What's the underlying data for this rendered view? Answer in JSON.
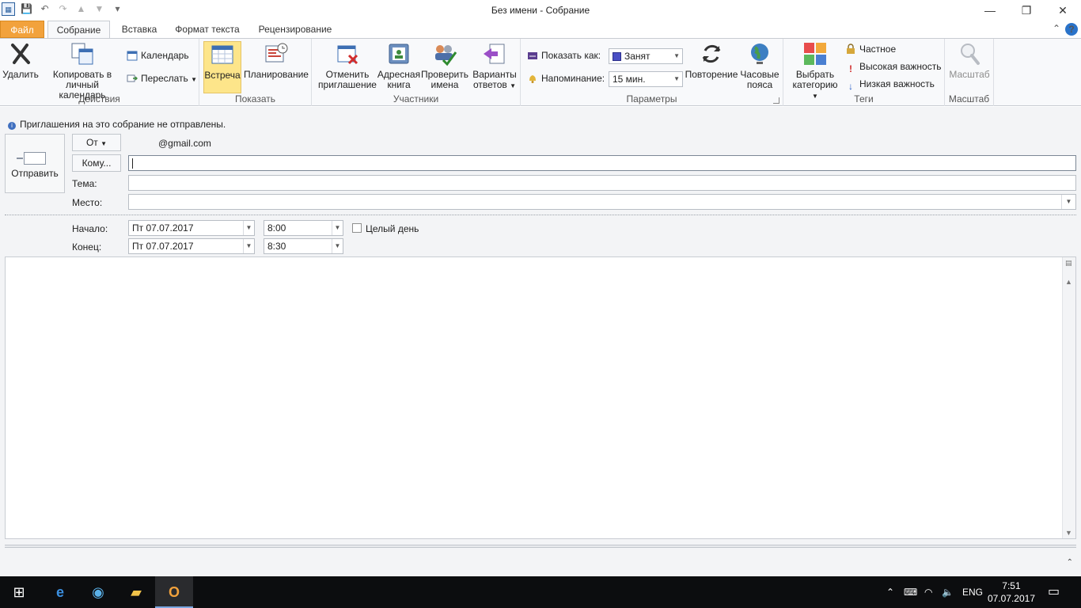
{
  "window": {
    "title": "Без имени  -  Собрание",
    "minimize_glyph": "—",
    "restore_glyph": "❐",
    "close_glyph": "✕"
  },
  "tabs": {
    "file": "Файл",
    "items": [
      "Собрание",
      "Вставка",
      "Формат текста",
      "Рецензирование"
    ],
    "active": "Собрание"
  },
  "ribbon": {
    "actions": {
      "label": "Действия",
      "delete": "Удалить",
      "copy_to_calendar_1": "Копировать в",
      "copy_to_calendar_2": "личный календарь",
      "calendar": "Календарь",
      "forward": "Переслать"
    },
    "show": {
      "label": "Показать",
      "meeting": "Встреча",
      "scheduling": "Планирование"
    },
    "attendees": {
      "label": "Участники",
      "cancel_invite_1": "Отменить",
      "cancel_invite_2": "приглашение",
      "address_book_1": "Адресная",
      "address_book_2": "книга",
      "check_names_1": "Проверить",
      "check_names_2": "имена",
      "response_options_1": "Варианты",
      "response_options_2": "ответов"
    },
    "options": {
      "label": "Параметры",
      "show_as_label": "Показать как:",
      "show_as_value": "Занят",
      "reminder_label": "Напоминание:",
      "reminder_value": "15 мин.",
      "recurrence": "Повторение",
      "time_zones_1": "Часовые",
      "time_zones_2": "пояса",
      "busy_color": "#4a4fc4"
    },
    "tags": {
      "label": "Теги",
      "categorize_1": "Выбрать",
      "categorize_2": "категорию",
      "private": "Частное",
      "high_importance": "Высокая важность",
      "low_importance": "Низкая важность"
    },
    "zoom": {
      "label": "Масштаб",
      "zoom": "Масштаб"
    }
  },
  "form": {
    "info": "Приглашения на это собрание не отправлены.",
    "send": "Отправить",
    "from_button": "От",
    "from_value": "@gmail.com",
    "to_button": "Кому...",
    "to_value": "",
    "subject_label": "Тема:",
    "subject_value": "",
    "location_label": "Место:",
    "location_value": "",
    "start_label": "Начало:",
    "start_date": "Пт 07.07.2017",
    "start_time": "8:00",
    "end_label": "Конец:",
    "end_date": "Пт 07.07.2017",
    "end_time": "8:30",
    "all_day": "Целый день",
    "all_day_checked": false
  },
  "taskbar": {
    "language": "ENG",
    "time": "7:51",
    "date": "07.07.2017"
  },
  "colors": {
    "file_tab": "#f2a23c",
    "selected_button": "#fde58a",
    "accent": "#2a73c9"
  }
}
